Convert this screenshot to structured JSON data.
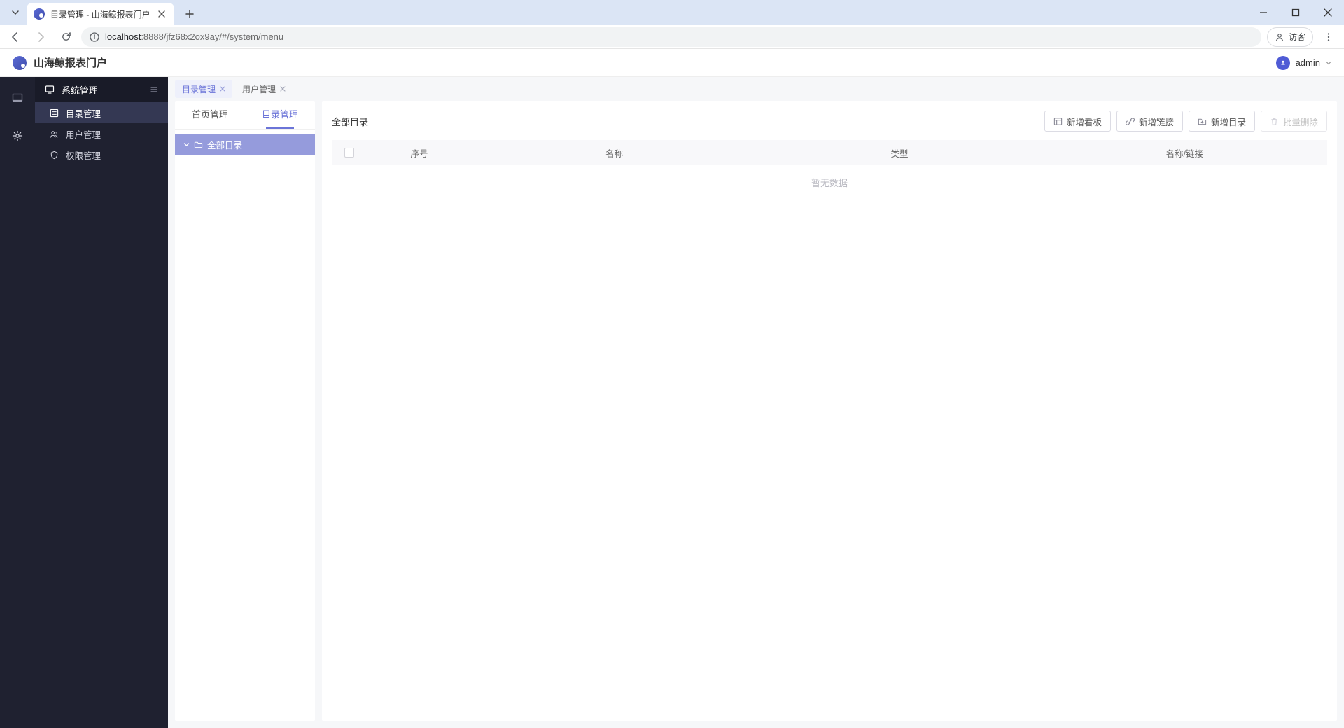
{
  "browser": {
    "tab_title": "目录管理 - 山海鲸报表门户",
    "url_host": "localhost",
    "url_port": ":8888",
    "url_path": "/jfz68x2ox9ay/#/system/menu",
    "guest_label": "访客"
  },
  "header": {
    "app_name": "山海鲸报表门户",
    "user_name": "admin"
  },
  "sidebar": {
    "group_label": "系统管理",
    "items": [
      {
        "label": "目录管理"
      },
      {
        "label": "用户管理"
      },
      {
        "label": "权限管理"
      }
    ]
  },
  "page_tabs": [
    {
      "label": "目录管理",
      "active": true
    },
    {
      "label": "用户管理",
      "active": false
    }
  ],
  "left_panel_tabs": [
    {
      "label": "首页管理",
      "active": false
    },
    {
      "label": "目录管理",
      "active": true
    }
  ],
  "tree": {
    "root_label": "全部目录"
  },
  "main": {
    "breadcrumb": "全部目录",
    "buttons": {
      "add_board": "新增看板",
      "add_link": "新增链接",
      "add_dir": "新增目录",
      "batch_delete": "批量删除"
    },
    "table": {
      "columns": {
        "index": "序号",
        "name": "名称",
        "type": "类型",
        "title_link": "名称/链接"
      },
      "empty_text": "暂无数据"
    }
  }
}
